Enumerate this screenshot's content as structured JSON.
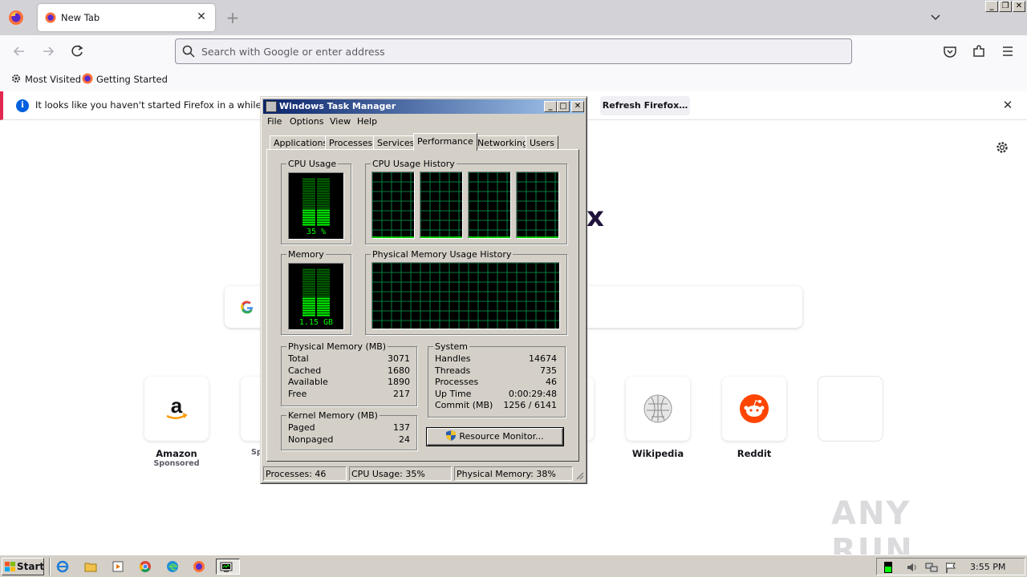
{
  "browser": {
    "tab": {
      "title": "New Tab"
    },
    "urlbar": {
      "placeholder": "Search with Google or enter address"
    },
    "bookmarks": [
      {
        "label": "Most Visited",
        "icon": "gear-icon"
      },
      {
        "label": "Getting Started",
        "icon": "firefox-icon"
      }
    ],
    "notification": {
      "text": "It looks like you haven't started Firefox in a while. Do you",
      "button": "Refresh Firefox…"
    },
    "newtab": {
      "brand_fragment": "x",
      "shortcuts": [
        {
          "label": "Amazon",
          "sub": "Sponsored",
          "icon": "amazon-icon"
        },
        {
          "label": "",
          "sub": "Sp",
          "icon": "partial-icon"
        },
        {
          "label": "Wikipedia",
          "sub": "",
          "icon": "wikipedia-icon"
        },
        {
          "label": "Reddit",
          "sub": "",
          "icon": "reddit-icon"
        },
        {
          "label": "",
          "sub": "",
          "icon": "empty-tile"
        }
      ]
    },
    "watermark": "ANY RUN"
  },
  "taskmgr": {
    "title": "Windows Task Manager",
    "menu": [
      "File",
      "Options",
      "View",
      "Help"
    ],
    "tabs": [
      "Applications",
      "Processes",
      "Services",
      "Performance",
      "Networking",
      "Users"
    ],
    "active_tab": "Performance",
    "groups": {
      "cpu_usage": "CPU Usage",
      "cpu_history": "CPU Usage History",
      "memory": "Memory",
      "mem_history": "Physical Memory Usage History",
      "physical_memory": "Physical Memory (MB)",
      "kernel_memory": "Kernel Memory (MB)",
      "system": "System"
    },
    "cpu_percent_label": "35 %",
    "cpu_level": 0.35,
    "memory_label": "1.15 GB",
    "memory_level": 0.38,
    "physical_memory": [
      {
        "label": "Total",
        "value": "3071"
      },
      {
        "label": "Cached",
        "value": "1680"
      },
      {
        "label": "Available",
        "value": "1890"
      },
      {
        "label": "Free",
        "value": "217"
      }
    ],
    "kernel_memory": [
      {
        "label": "Paged",
        "value": "137"
      },
      {
        "label": "Nonpaged",
        "value": "24"
      }
    ],
    "system": [
      {
        "label": "Handles",
        "value": "14674"
      },
      {
        "label": "Threads",
        "value": "735"
      },
      {
        "label": "Processes",
        "value": "46"
      },
      {
        "label": "Up Time",
        "value": "0:00:29:48"
      },
      {
        "label": "Commit (MB)",
        "value": "1256 / 6141"
      }
    ],
    "resource_monitor_button": "Resource Monitor...",
    "status": {
      "processes": "Processes: 46",
      "cpu": "CPU Usage: 35%",
      "memory": "Physical Memory: 38%"
    }
  },
  "taskbar": {
    "start_label": "Start",
    "clock": "3:55 PM"
  },
  "colors": {
    "meter_green": "#00ff00",
    "graph_grid": "#008040",
    "title_gradient_start": "#0a246a",
    "title_gradient_end": "#a6caf0",
    "notice_accent": "#e22850"
  }
}
